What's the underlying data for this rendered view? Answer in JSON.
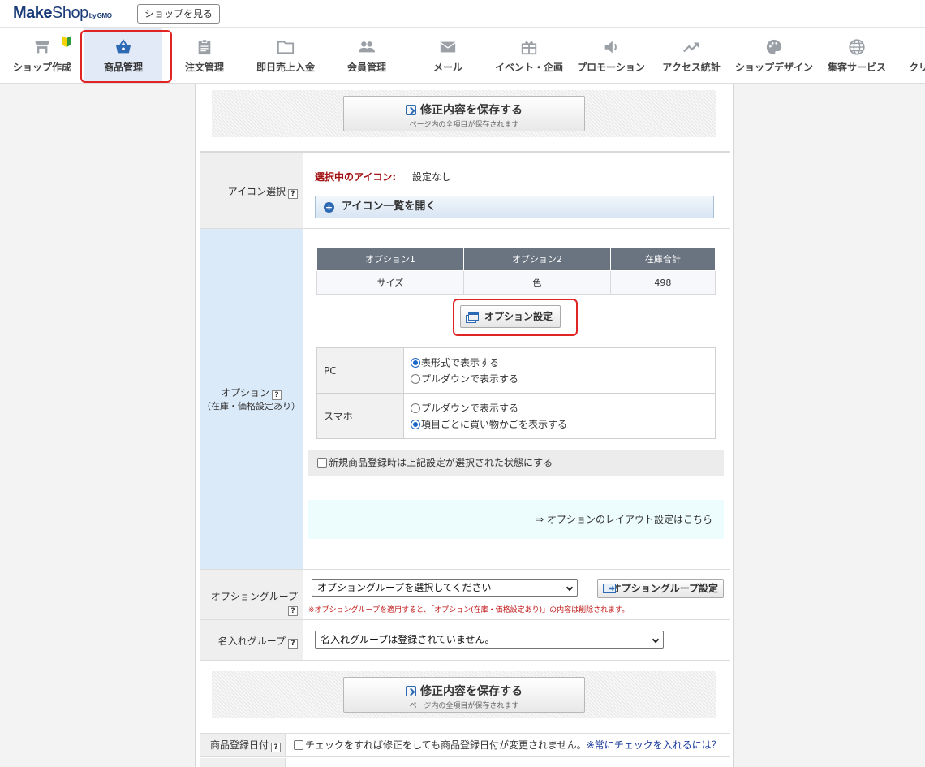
{
  "header": {
    "logo_main": "Make",
    "logo_thin": "Shop",
    "logo_suffix": "by GMO",
    "view_shop_label": "ショップを見る"
  },
  "nav": {
    "items": [
      {
        "label": "ショップ作成",
        "icon": "shop-icon"
      },
      {
        "label": "商品管理",
        "icon": "basket-icon",
        "active": true
      },
      {
        "label": "注文管理",
        "icon": "clipboard-icon"
      },
      {
        "label": "即日売上入金",
        "icon": "folder-icon"
      },
      {
        "label": "会員管理",
        "icon": "people-icon"
      },
      {
        "label": "メール",
        "icon": "mail-icon"
      },
      {
        "label": "イベント・企画",
        "icon": "gift-icon"
      },
      {
        "label": "プロモーション",
        "icon": "speaker-icon"
      },
      {
        "label": "アクセス統計",
        "icon": "trend-icon"
      },
      {
        "label": "ショップデザイン",
        "icon": "palette-icon"
      },
      {
        "label": "集客サービス",
        "icon": "globe-icon"
      },
      {
        "label": "クリ",
        "icon": ""
      }
    ],
    "beginner_icon": "beginner-leaf-icon"
  },
  "save": {
    "label": "修正内容を保存する",
    "sublabel": "ページ内の全項目が保存されます"
  },
  "icon_select": {
    "label": "アイコン選択",
    "selected_label": "選択中のアイコン:",
    "selected_value": "設定なし",
    "open_list_label": "アイコン一覧を開く"
  },
  "options": {
    "label_line1": "オプション",
    "label_line2": "（在庫・価格設定あり）",
    "table_headers": [
      "オプション1",
      "オプション2",
      "在庫合計"
    ],
    "table_values": [
      "サイズ",
      "色",
      "498"
    ],
    "setting_button": "オプション設定",
    "display": {
      "pc_label": "PC",
      "pc_options": [
        "表形式で表示する",
        "プルダウンで表示する"
      ],
      "pc_selected": 0,
      "sp_label": "スマホ",
      "sp_options": [
        "プルダウンで表示する",
        "項目ごとに買い物かごを表示する"
      ],
      "sp_selected": 1
    },
    "new_reg_label": "新規商品登録時は上記設定が選択された状態にする",
    "layout_link": "⇒ オプションのレイアウト設定はこちら"
  },
  "option_group": {
    "label": "オプショングループ",
    "select_value": "オプショングループを選択してください",
    "button_label": "オプショングループ設定",
    "warning": "※オプショングループを適用すると、「オプション(在庫・価格設定あり)」の内容は削除されます。"
  },
  "name_group": {
    "label": "名入れグループ",
    "select_value": "名入れグループは登録されていません。"
  },
  "reg_date": {
    "label": "商品登録日付",
    "checkbox_label": "チェックをすれば修正をしても商品登録日付が変更されません。",
    "link_label": "※常にチェックを入れるには？"
  },
  "colors": {
    "accent": "#2d6ab3",
    "highlight": "#e02424",
    "warning": "#c01818",
    "active_nav": "#e3eaf7"
  }
}
